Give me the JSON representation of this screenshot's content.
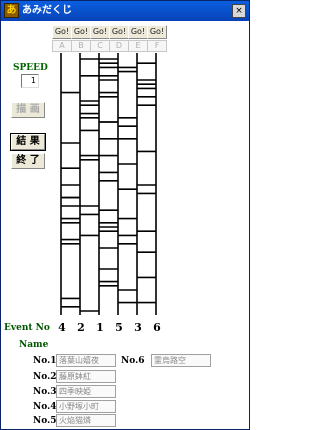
{
  "window": {
    "title": "あみだくじ",
    "app_icon": "amida-app-icon",
    "close_glyph": "×"
  },
  "go_label": "Go!",
  "columns": [
    "A",
    "B",
    "C",
    "D",
    "E",
    "F"
  ],
  "speed": {
    "label": "SPEED",
    "value": "1"
  },
  "buttons": {
    "draw": "描 画",
    "result": "結 果",
    "end": "終 了"
  },
  "event": {
    "label": "Event No",
    "numbers": [
      "4",
      "2",
      "1",
      "5",
      "3",
      "6"
    ]
  },
  "names": {
    "heading": "Name",
    "entries": [
      {
        "label": "No.1",
        "value": "落葉山嬉夜"
      },
      {
        "label": "No.2",
        "value": "藤原鉢紅"
      },
      {
        "label": "No.3",
        "value": "四季映姫"
      },
      {
        "label": "No.4",
        "value": "小野塚小町"
      },
      {
        "label": "No.5",
        "value": "火焔猫燐"
      },
      {
        "label": "No.6",
        "value": "霊烏路空"
      }
    ]
  }
}
